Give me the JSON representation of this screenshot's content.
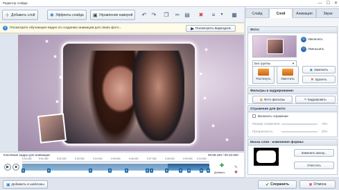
{
  "window": {
    "title": "Редактор слайда",
    "controls": [
      "—",
      "☐",
      "✕"
    ]
  },
  "toolbar": {
    "add_layer": "Добавить слой",
    "slide_effects": "Эффекты слайда",
    "camera": "Управление камерой"
  },
  "tips": {
    "text": "Посмотрите обучающее видео по созданию анимации для своих фото...",
    "video_button": "Посмотреть видеоурок"
  },
  "right_panel": {
    "tabs": [
      "Слайд",
      "Слой",
      "Анимация",
      "Звуки"
    ],
    "active_tab": "Слой",
    "photo": {
      "header": "Фото:",
      "group_select": "Без группы",
      "zoom_in": "Увеличить",
      "zoom_out": "Уменьшить",
      "stretch": "Растянуть",
      "fit": "Уместить",
      "replace": "Заменить",
      "delete": "Удалить"
    },
    "filters": {
      "header": "Фильтры и кадрирование:",
      "photo_filters": "Фото фильтры",
      "crop": "Кадрировать"
    },
    "reflection": {
      "header": "Отражение для фото:",
      "enable": "Включить отражение",
      "size_label": "Размер отражения:",
      "size_value": "15%",
      "opacity_label": "Прозрачность:",
      "opacity_value": "30%"
    },
    "mask": {
      "header": "Маска слоя - изменение формы:",
      "change": "Заменить маску...",
      "clear": "Очистить"
    }
  },
  "timeline": {
    "label": "Ключевые кадры для анимации:",
    "time": "00:08.180 / 00:10.500",
    "ticks": [
      "0:00.000",
      "0:01.000",
      "0:02.000",
      "0:03.000",
      "0:04.000",
      "0:05.000",
      "0:06.000",
      "0:07.000",
      "0:08.000",
      "0:09.000",
      "0:10.000"
    ],
    "add_label": "Добавить",
    "keyframes": [
      "1",
      "2",
      "3",
      "4",
      "5",
      "6",
      "7",
      "8",
      "9",
      "10",
      "11",
      "12"
    ]
  },
  "bottom": {
    "templates": "Добавить в шаблоны",
    "save": "Сохранить",
    "cancel": "Отмена"
  },
  "colors": {
    "accent": "#2d86d1",
    "save_icon": "#2aa043",
    "cancel_icon": "#d04040"
  }
}
